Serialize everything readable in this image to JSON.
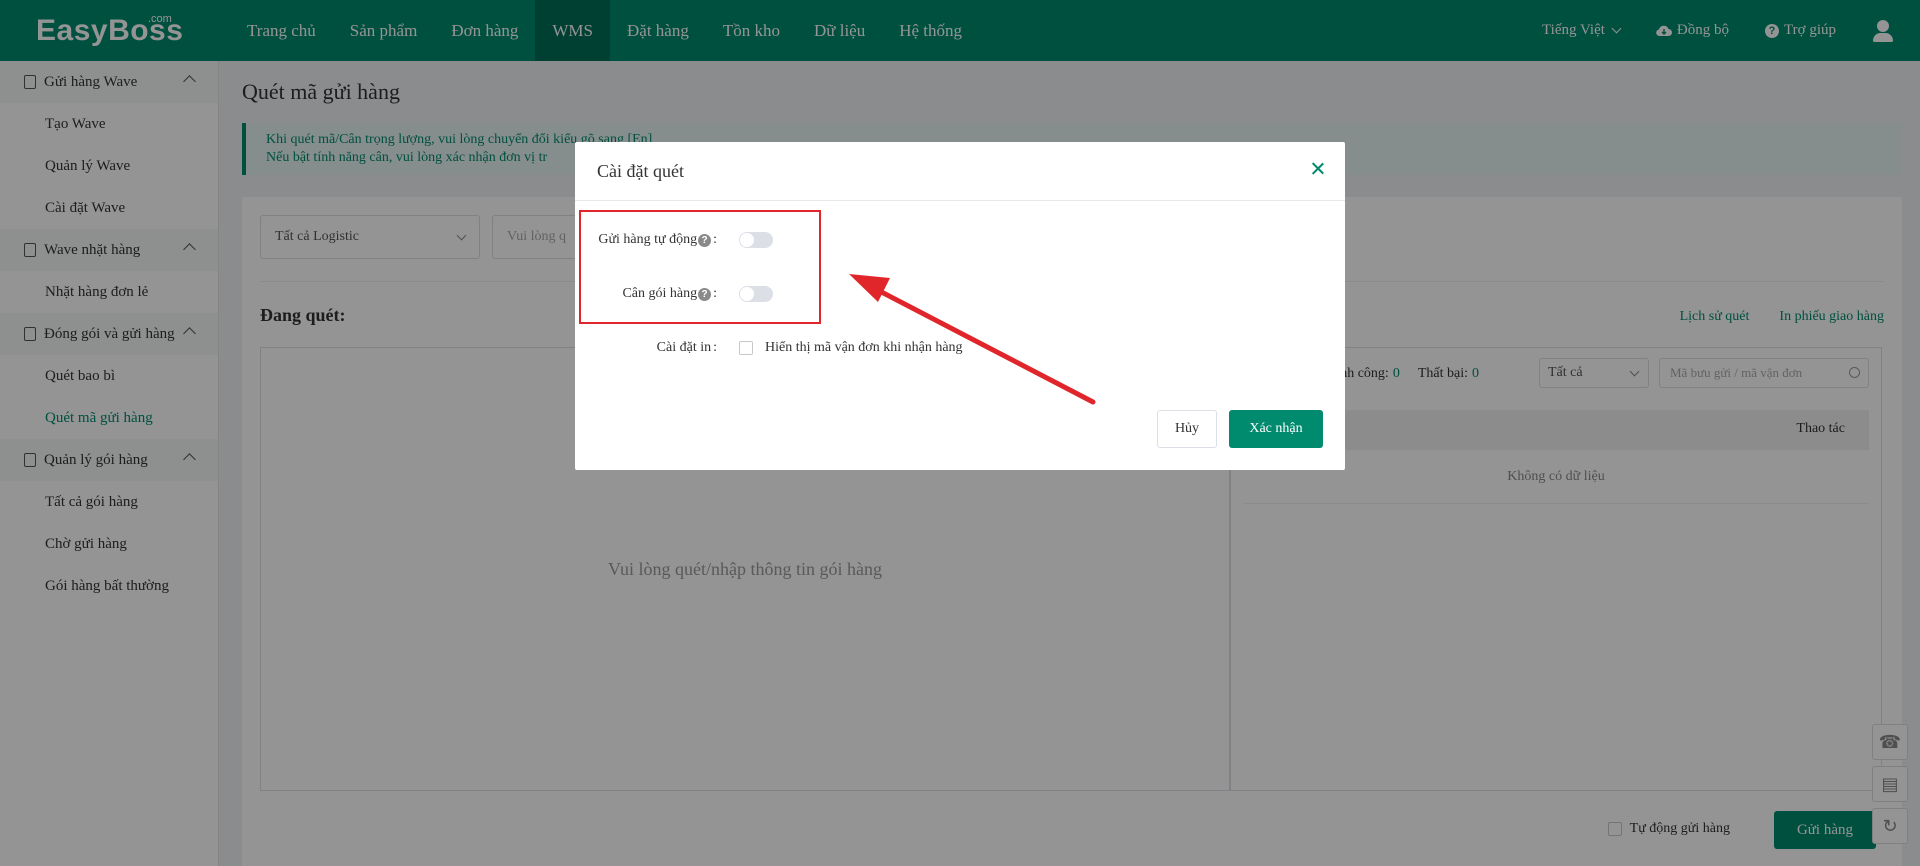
{
  "app": {
    "logo": "EasyBoss",
    "logo_suffix": ".com"
  },
  "nav": [
    {
      "label": "Trang chủ"
    },
    {
      "label": "Sản phẩm"
    },
    {
      "label": "Đơn hàng"
    },
    {
      "label": "WMS"
    },
    {
      "label": "Đặt hàng"
    },
    {
      "label": "Tồn kho"
    },
    {
      "label": "Dữ liệu"
    },
    {
      "label": "Hệ thống"
    }
  ],
  "topright": {
    "language": "Tiếng Việt",
    "sync": "Đồng bộ",
    "help": "Trợ giúp"
  },
  "sidebar": {
    "groups": [
      {
        "label": "Gửi hàng Wave",
        "items": [
          "Tạo Wave",
          "Quản lý Wave",
          "Cài đặt Wave"
        ]
      },
      {
        "label": "Wave nhặt hàng",
        "items": [
          "Nhặt hàng đơn lẻ"
        ]
      },
      {
        "label": "Đóng gói và gửi hàng",
        "items": [
          "Quét bao bì",
          "Quét mã gửi hàng"
        ]
      },
      {
        "label": "Quản lý gói hàng",
        "items": [
          "Tất cả gói hàng",
          "Chờ gửi hàng",
          "Gói hàng bất thường"
        ]
      }
    ]
  },
  "main": {
    "title": "Quét mã gửi hàng",
    "notice_line1": "Khi quét mã/Cân trọng lượng, vui lòng chuyển đổi kiểu gõ sang [En]",
    "notice_line2": "Nếu bật tính năng cân, vui lòng xác nhận đơn vị tr",
    "logistic_select": "Tất cả Logistic",
    "scan_input_placeholder": "Vui lòng q",
    "scan_label": "Đang quét:",
    "scan_placeholder": "Vui lòng quét/nhập thông tin gói hàng",
    "links": {
      "history": "Lịch sử quét",
      "print": "In phiếu giao hàng"
    },
    "stats": {
      "success_label": "hành công:",
      "success": "0",
      "fail_label": "Thất bại:",
      "fail": "0"
    },
    "filter": "Tất cả",
    "search_placeholder": "Mã bưu gửi / mã vận đơn",
    "table_action": "Thao tác",
    "no_data": "Không có dữ liệu",
    "auto_send": "Tự động gửi hàng",
    "send_button": "Gửi hàng"
  },
  "modal": {
    "title": "Cài đặt quét",
    "auto_send_label": "Gửi hàng tự động",
    "weigh_label": "Cân gói hàng",
    "print_label": "Cài đặt in",
    "print_option": "Hiển thị mã vận đơn khi nhận hàng",
    "cancel": "Hủy",
    "confirm": "Xác nhận",
    "auto_send_on": false,
    "weigh_on": false
  },
  "icons": {
    "help": "?",
    "colon": ":"
  },
  "colors": {
    "brand": "#008a6e",
    "highlight": "#e0262b"
  }
}
